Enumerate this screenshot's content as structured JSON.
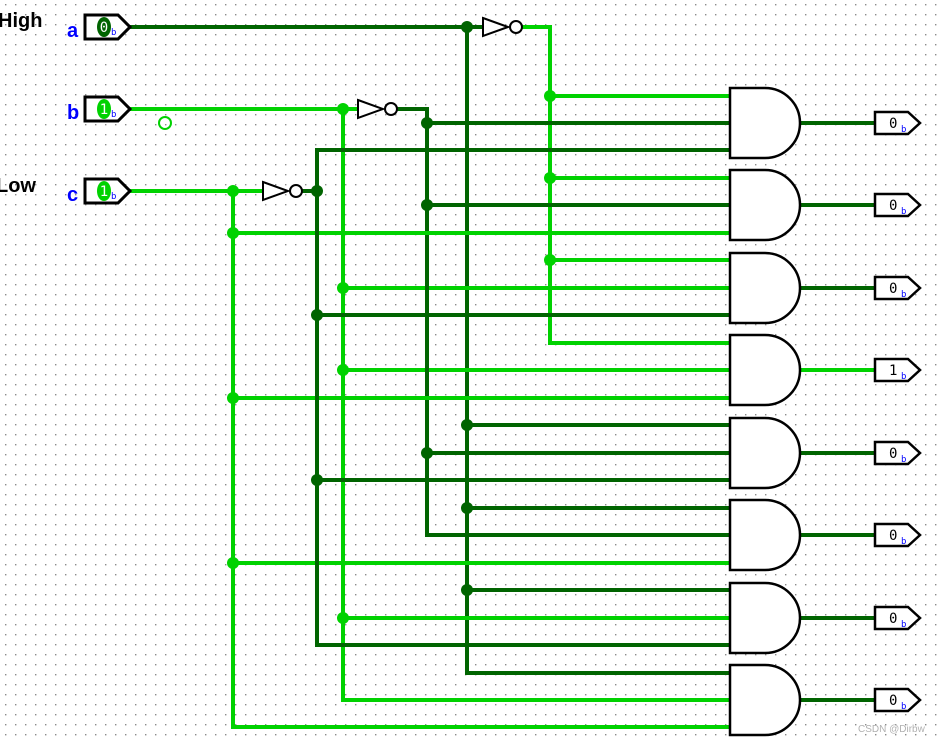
{
  "labels": {
    "high": "High",
    "low": "Low"
  },
  "inputs": [
    {
      "name": "a",
      "value": "0",
      "radix": "b"
    },
    {
      "name": "b",
      "value": "1",
      "radix": "b"
    },
    {
      "name": "c",
      "value": "1",
      "radix": "b"
    }
  ],
  "outputs": [
    {
      "value": "0",
      "radix": "b"
    },
    {
      "value": "0",
      "radix": "b"
    },
    {
      "value": "0",
      "radix": "b"
    },
    {
      "value": "1",
      "radix": "b"
    },
    {
      "value": "0",
      "radix": "b"
    },
    {
      "value": "0",
      "radix": "b"
    },
    {
      "value": "0",
      "radix": "b"
    },
    {
      "value": "0",
      "radix": "b"
    }
  ],
  "watermark": "CSDN @Dirbw",
  "colors": {
    "high_wire": "#00d200",
    "low_wire": "#006400",
    "pin_label": "#0000ff",
    "grid_dot": "#8a8a8a"
  }
}
